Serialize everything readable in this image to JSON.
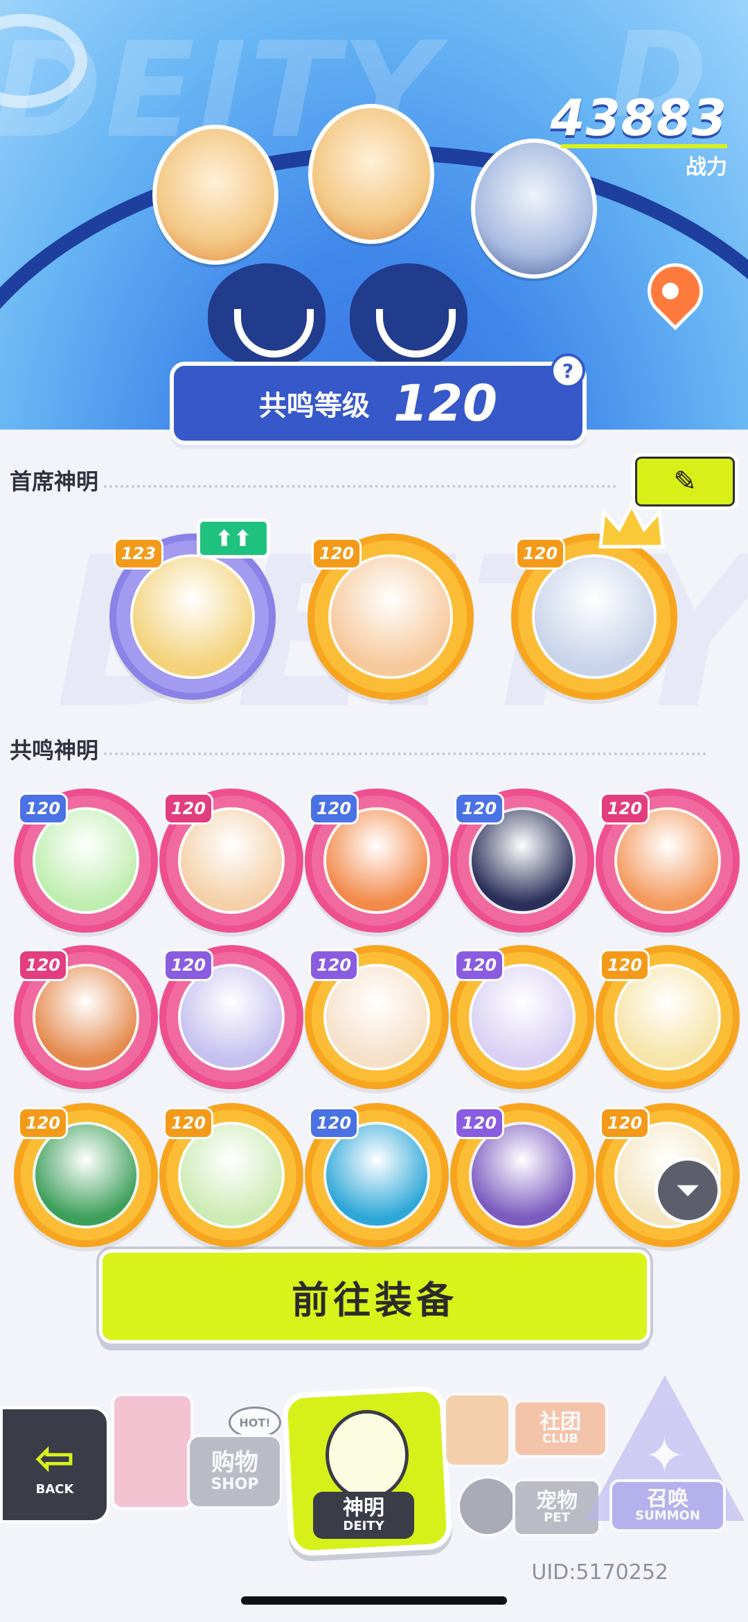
{
  "header": {
    "bg_word": "DEITY",
    "power": {
      "value": "43883",
      "label": "战力"
    },
    "resonance": {
      "label": "共鸣等级",
      "value": "120",
      "help": "?"
    }
  },
  "sections": {
    "chief": {
      "title": "首席神明",
      "edit_icon": "pencil-icon"
    },
    "resonant": {
      "title": "共鸣神明"
    }
  },
  "chief_deities": [
    {
      "level": "123",
      "frame": "purple",
      "level_color": "orange",
      "up_badge": "⬆⬆",
      "face": "#f3d27a"
    },
    {
      "level": "120",
      "frame": "orange",
      "face": "#f6c89a"
    },
    {
      "level": "120",
      "frame": "orange",
      "face": "#c9d3ea",
      "crown": true
    }
  ],
  "resonant_deities": [
    {
      "level": "120",
      "frame": "pink",
      "lv": "blue",
      "face": "#bfeeb0"
    },
    {
      "level": "120",
      "frame": "pink",
      "lv": "pink",
      "face": "#f4d0a8"
    },
    {
      "level": "120",
      "frame": "pink",
      "lv": "blue",
      "face": "#f28a4a"
    },
    {
      "level": "120",
      "frame": "pink",
      "lv": "blue",
      "face": "#2b2f59"
    },
    {
      "level": "120",
      "frame": "pink",
      "lv": "pink",
      "face": "#f39a5e"
    },
    {
      "level": "120",
      "frame": "pink",
      "lv": "pink",
      "face": "#e48a4d"
    },
    {
      "level": "120",
      "frame": "pink",
      "lv": "purple",
      "face": "#c6c0ef"
    },
    {
      "level": "120",
      "frame": "orange",
      "lv": "purple",
      "face": "#f6e0c8"
    },
    {
      "level": "120",
      "frame": "orange",
      "lv": "purple",
      "face": "#d9d0f4"
    },
    {
      "level": "120",
      "frame": "orange",
      "lv": "orange",
      "face": "#f7e4a8"
    },
    {
      "level": "120",
      "frame": "orange",
      "lv": "orange",
      "face": "#3e9f5b"
    },
    {
      "level": "120",
      "frame": "orange",
      "lv": "orange",
      "face": "#cdebb5"
    },
    {
      "level": "120",
      "frame": "orange",
      "lv": "blue",
      "face": "#2ea7d8"
    },
    {
      "level": "120",
      "frame": "orange",
      "lv": "purple",
      "face": "#7b5bbf"
    },
    {
      "level": "120",
      "frame": "orange",
      "lv": "orange",
      "face": "#f4e6c2"
    }
  ],
  "filter_icon": "filter-icon",
  "equip_button": {
    "label": "前往装备"
  },
  "nav": {
    "back": {
      "icon": "back-arrow-icon",
      "caption": "BACK"
    },
    "shop": {
      "label": "购物",
      "sub": "SHOP",
      "hot": "HOT!"
    },
    "deity": {
      "label": "神明",
      "sub": "DEITY"
    },
    "club": {
      "label": "社团",
      "sub": "CLUB"
    },
    "pet": {
      "label": "宠物",
      "sub": "PET"
    },
    "summon": {
      "label": "召唤",
      "sub": "SUMMON"
    }
  },
  "uid": "UID:5170252",
  "colors": {
    "accent": "#d8f21a",
    "primary": "#3658c8",
    "pink": "#ee4f8f",
    "orange": "#f7a51f"
  }
}
